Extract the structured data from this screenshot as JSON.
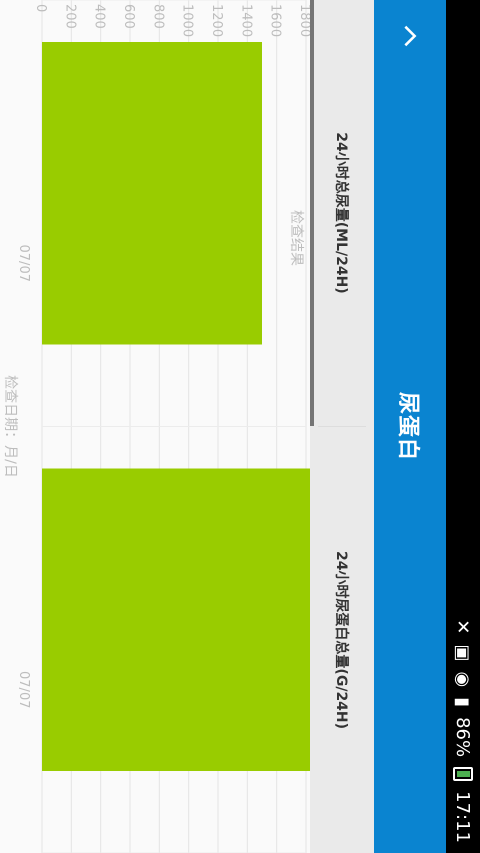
{
  "status_bar": {
    "time": "17:11",
    "battery_percent": "86%",
    "icons": [
      "alarm-icon",
      "sim-icon",
      "wifi-icon",
      "signal-icon",
      "battery-icon"
    ]
  },
  "app_bar": {
    "title": "尿蛋白",
    "back_icon": "chevron-up-icon"
  },
  "tabs": [
    {
      "label": "24小时总尿量(ML/24H)",
      "active": true
    },
    {
      "label": "24小时尿蛋白总量(G/24H)",
      "active": false
    }
  ],
  "chart_data": {
    "type": "bar",
    "title": "检查结果",
    "xlabel": "检查日期：月/日",
    "ylabel": "检查结果",
    "categories": [
      "07/07",
      "07/07"
    ],
    "values": [
      1500,
      2000
    ],
    "ylim": [
      0,
      1800
    ],
    "yticks": [
      0,
      200,
      400,
      600,
      800,
      1000,
      1200,
      1400,
      1600,
      1800
    ],
    "bar_color": "#99cc00",
    "grid": true
  },
  "colors": {
    "app_bar": "#0a84d0",
    "bar": "#99cc00",
    "status_bar": "#000000"
  }
}
